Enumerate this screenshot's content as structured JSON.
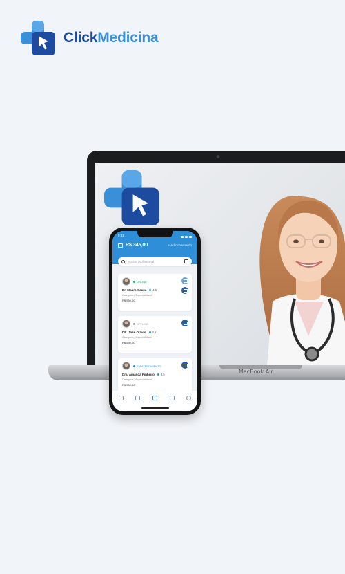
{
  "brand": {
    "name_part1": "Click",
    "name_part2": "Medicina"
  },
  "laptop": {
    "label": "MacBook Air"
  },
  "app": {
    "status_time": "9:41",
    "balance": "R$ 345,00",
    "add_balance": "+ Adicionar saldo",
    "search_placeholder": "Buscar profissional",
    "doctors": [
      {
        "status": "ONLINE",
        "status_color": "#23b26d",
        "name": "Dr. Mauro Souza",
        "rating": "4.5",
        "category": "Categoria | Especialidade",
        "price": "R$ 550,00"
      },
      {
        "status": "OFFLINE",
        "status_color": "#9aa3ad",
        "name": "DR. José Otávio",
        "rating": "4.5",
        "category": "Categoria | Especialidade",
        "price": "R$ 550,00"
      },
      {
        "status": "EM ATENDIMENTO",
        "status_color": "#2e8fd8",
        "name": "Dra. Amanda Pinheiro",
        "rating": "4.5",
        "category": "Categoria | Especialidade",
        "price": "R$ 550,00"
      }
    ],
    "tabs": [
      "calendar-icon",
      "pencil-icon",
      "home-icon",
      "document-icon",
      "profile-icon"
    ]
  },
  "colors": {
    "brand_dark": "#1d4ba0",
    "brand_light": "#3a8fd9",
    "app_header": "#2e8fd8"
  }
}
